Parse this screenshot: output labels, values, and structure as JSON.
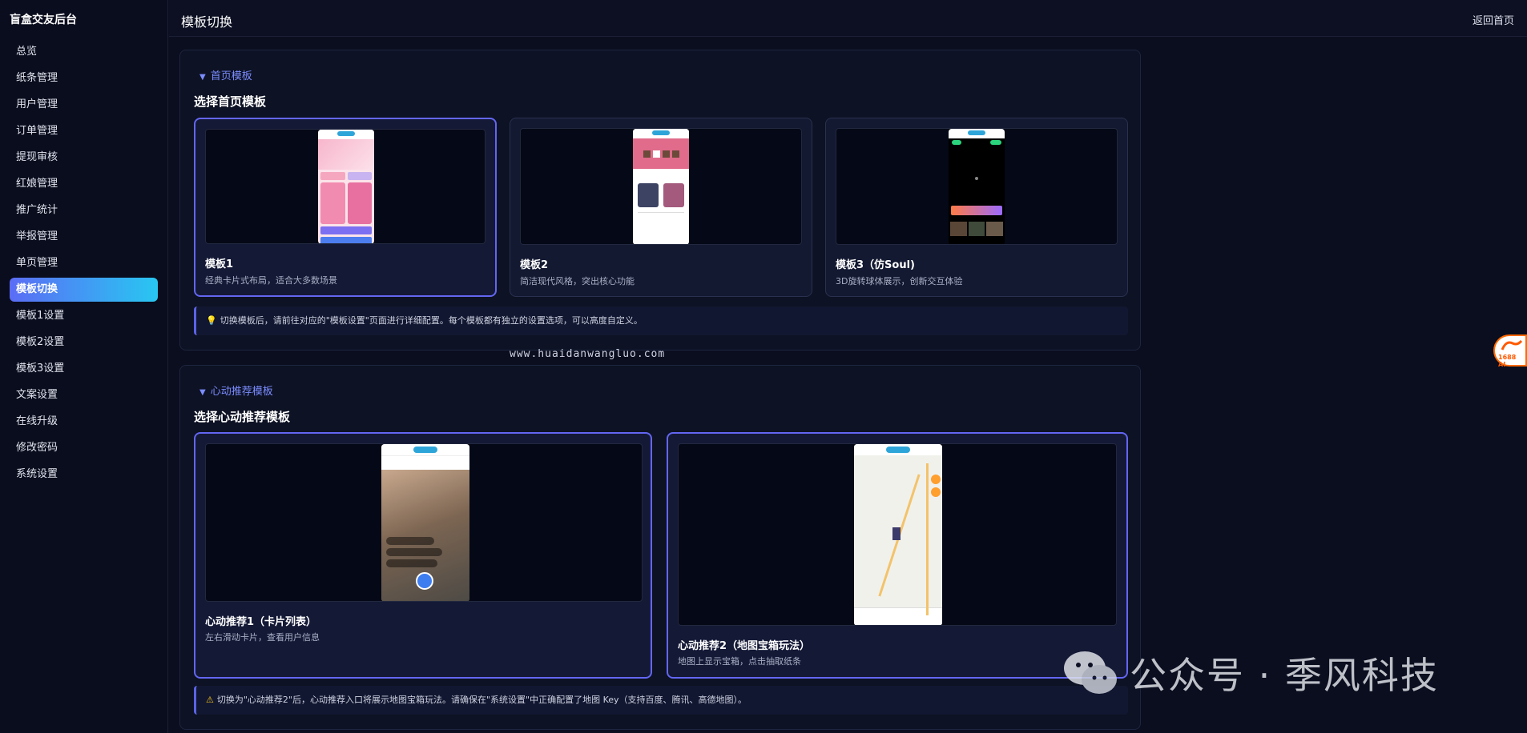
{
  "sidebar": {
    "title": "盲盒交友后台",
    "items": [
      {
        "label": "总览"
      },
      {
        "label": "纸条管理"
      },
      {
        "label": "用户管理"
      },
      {
        "label": "订单管理"
      },
      {
        "label": "提现审核"
      },
      {
        "label": "红娘管理"
      },
      {
        "label": "推广统计"
      },
      {
        "label": "举报管理"
      },
      {
        "label": "单页管理"
      },
      {
        "label": "模板切换",
        "active": true
      },
      {
        "label": "模板1设置"
      },
      {
        "label": "模板2设置"
      },
      {
        "label": "模板3设置"
      },
      {
        "label": "文案设置"
      },
      {
        "label": "在线升级"
      },
      {
        "label": "修改密码"
      },
      {
        "label": "系统设置"
      }
    ]
  },
  "header": {
    "title": "模板切换",
    "home_link": "返回首页"
  },
  "home_section": {
    "collapse_label": "首页模板",
    "heading": "选择首页模板",
    "templates": [
      {
        "name": "模板1",
        "desc": "经典卡片式布局，适合大多数场景",
        "selected": true
      },
      {
        "name": "模板2",
        "desc": "简洁现代风格，突出核心功能",
        "selected": false
      },
      {
        "name": "模板3（仿Soul)",
        "desc": "3D旋转球体展示，创新交互体验",
        "selected": false
      }
    ],
    "tip": "切换模板后，请前往对应的\"模板设置\"页面进行详细配置。每个模板都有独立的设置选项，可以高度自定义。"
  },
  "heart_section": {
    "collapse_label": "心动推荐模板",
    "heading": "选择心动推荐模板",
    "templates": [
      {
        "name": "心动推荐1（卡片列表）",
        "desc": "左右滑动卡片，查看用户信息",
        "selected": true
      },
      {
        "name": "心动推荐2（地图宝箱玩法）",
        "desc": "地图上显示宝箱，点击抽取纸条",
        "selected": true
      }
    ],
    "tip": "切换为\"心动推荐2\"后，心动推荐入口将展示地图宝箱玩法。请确保在\"系统设置\"中正确配置了地图 Key（支持百度、腾讯、高德地图）。"
  },
  "watermark": {
    "url": "www.huaidanwangluo.com",
    "wechat": "公众号 · 季风科技"
  },
  "badge": {
    "label": "1688 AI"
  },
  "colors": {
    "background": "#0b0e1f",
    "accent": "#6366f1",
    "active_gradient_start": "#5b6cf5",
    "active_gradient_end": "#28c7f2",
    "link": "#7b8cff"
  },
  "icons": {
    "tip1": "lightbulb-icon",
    "tip2": "warning-icon",
    "collapse": "caret-down-icon"
  }
}
